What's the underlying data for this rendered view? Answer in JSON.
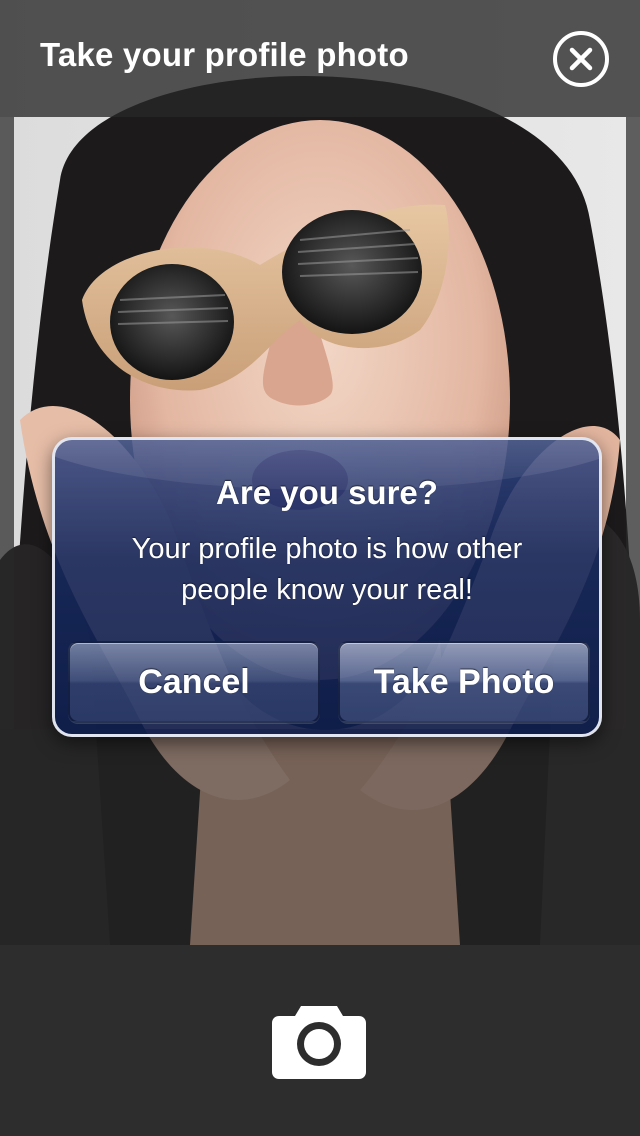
{
  "header": {
    "title": "Take your profile photo"
  },
  "alert": {
    "title": "Are you sure?",
    "message": "Your profile photo is how other people know your real!",
    "cancel_label": "Cancel",
    "confirm_label": "Take Photo"
  },
  "icons": {
    "close": "close-icon",
    "shutter": "camera-icon"
  },
  "colors": {
    "header_bg": "#282828",
    "toolbar_bg": "#2d2d2d",
    "alert_bg": "#16285c",
    "text": "#ffffff"
  }
}
